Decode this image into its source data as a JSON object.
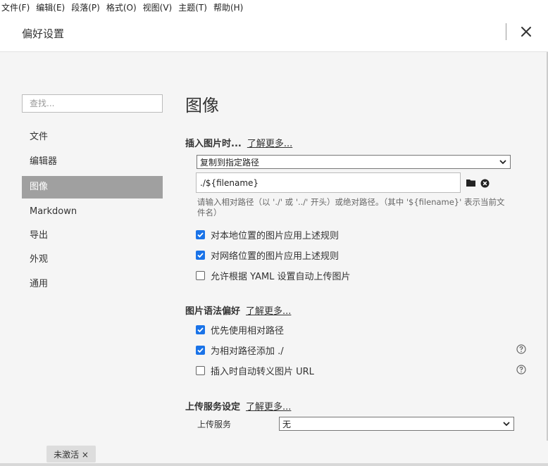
{
  "menu": [
    "文件(F)",
    "编辑(E)",
    "段落(P)",
    "格式(O)",
    "视图(V)",
    "主题(T)",
    "帮助(H)"
  ],
  "header": {
    "title": "偏好设置"
  },
  "sidebar": {
    "search_placeholder": "查找...",
    "items": [
      "文件",
      "编辑器",
      "图像",
      "Markdown",
      "导出",
      "外观",
      "通用"
    ],
    "active": "图像"
  },
  "main": {
    "title": "图像",
    "insert": {
      "heading": "插入图片时...",
      "learn_more": "了解更多...",
      "action": "复制到指定路径",
      "path": "./${filename}",
      "hint": "请输入相对路径（以 './' 或 '../' 开头）或绝对路径。（其中 '${filename}' 表示当前文件名）",
      "options": [
        {
          "label": "对本地位置的图片应用上述规则",
          "checked": true
        },
        {
          "label": "对网络位置的图片应用上述规则",
          "checked": true
        },
        {
          "label": "允许根据 YAML 设置自动上传图片",
          "checked": false
        }
      ]
    },
    "syntax": {
      "heading": "图片语法偏好",
      "learn_more": "了解更多...",
      "options": [
        {
          "label": "优先使用相对路径",
          "checked": true
        },
        {
          "label": "为相对路径添加 ./",
          "checked": true
        },
        {
          "label": "插入时自动转义图片 URL",
          "checked": false
        }
      ]
    },
    "upload": {
      "heading": "上传服务设定",
      "learn_more": "了解更多...",
      "service_label": "上传服务",
      "service_value": "无"
    }
  },
  "status": {
    "badge": "未激活 ×"
  },
  "colors": {
    "accent": "#1a73e8",
    "active_nav": "#a0a0a0"
  },
  "icons": [
    "close-icon",
    "folder-icon",
    "clear-icon",
    "chevron-down-icon",
    "help-icon",
    "check-icon"
  ]
}
